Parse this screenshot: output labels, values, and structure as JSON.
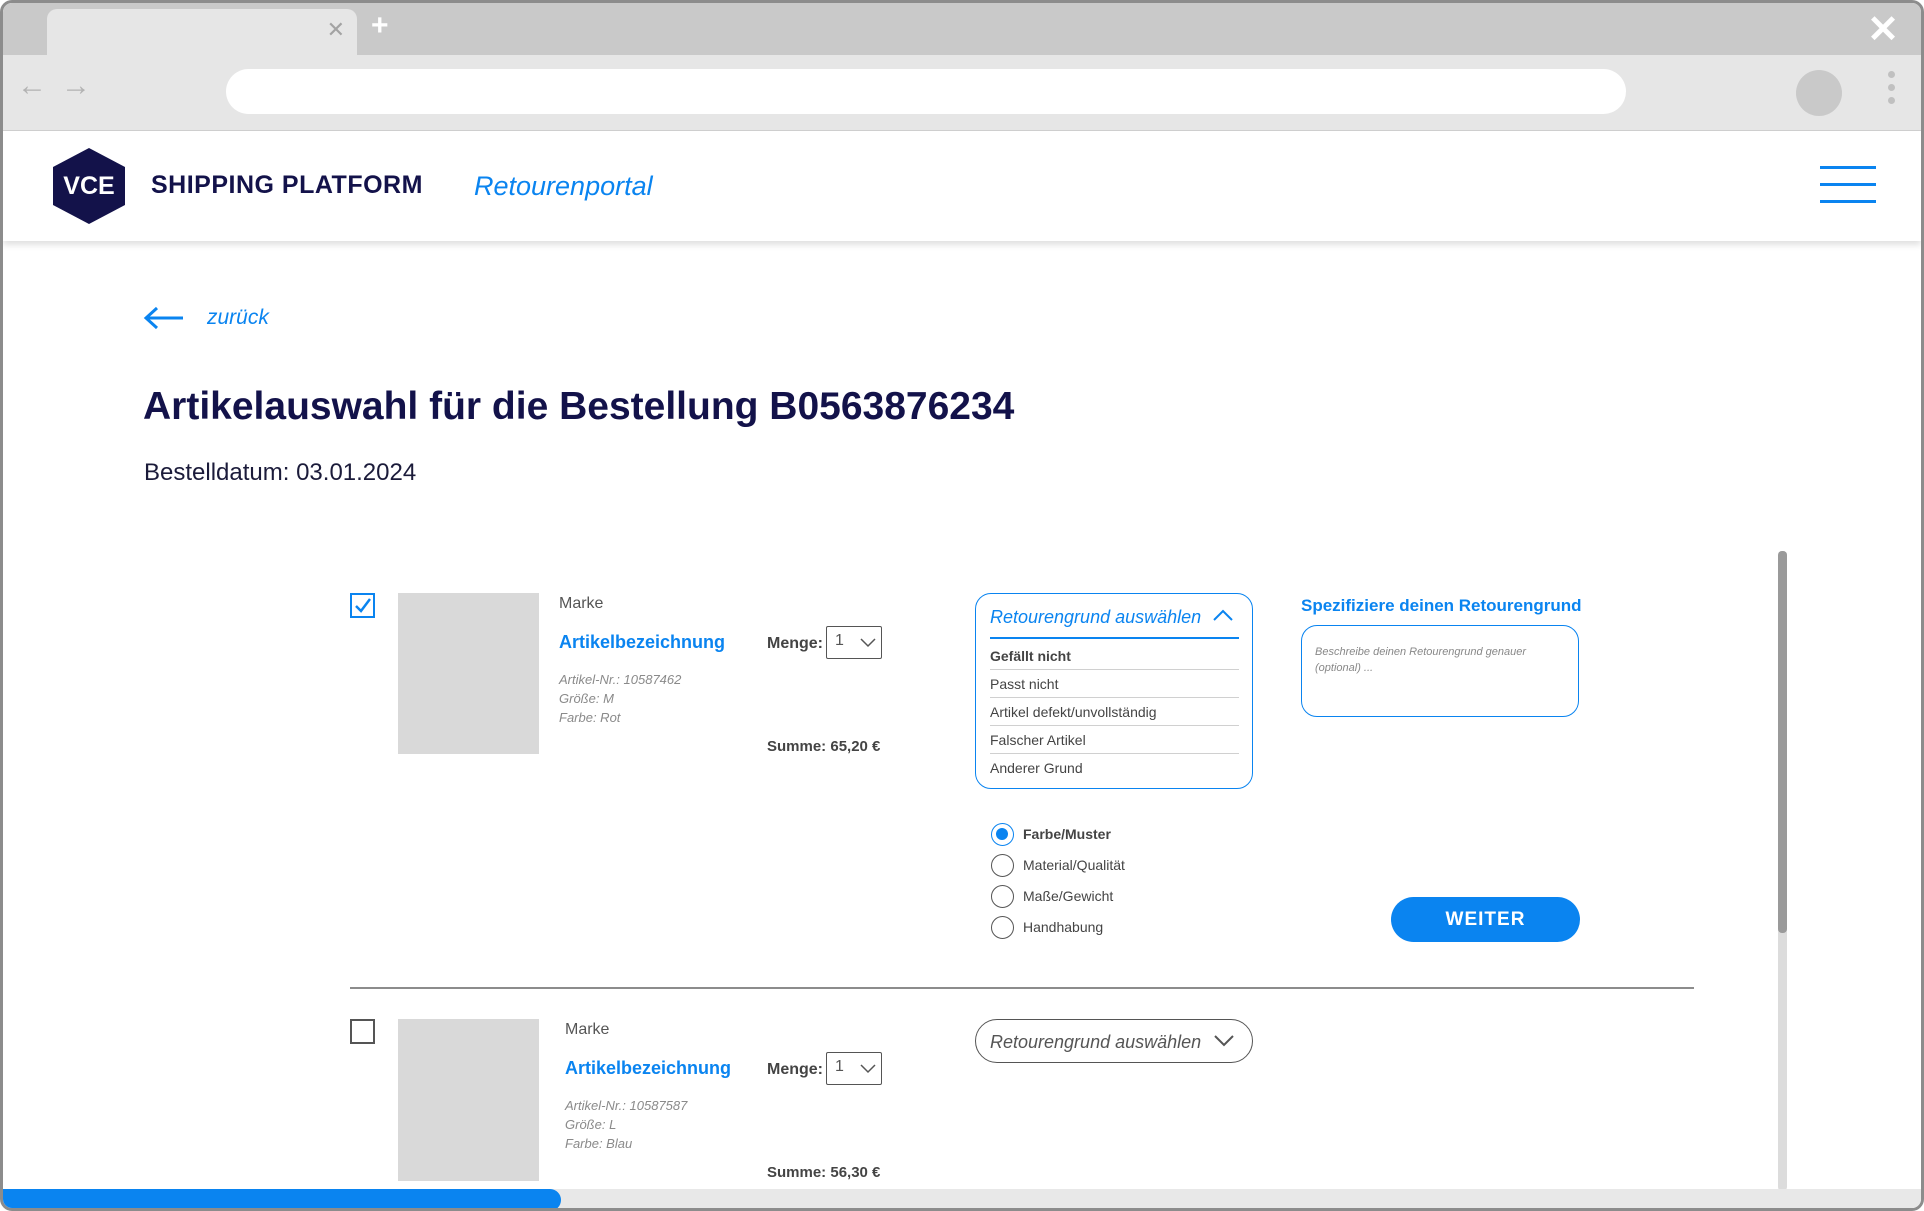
{
  "browser": {
    "tab_close_glyph": "✕",
    "new_tab_glyph": "+",
    "window_close_glyph": "✕",
    "back_glyph": "←",
    "forward_glyph": "→"
  },
  "header": {
    "logo_text": "VCE",
    "brand": "SHIPPING PLATFORM",
    "portal": "Retourenportal"
  },
  "page": {
    "back_label": "zurück",
    "title": "Artikelauswahl für die Bestellung B0563876234",
    "order_date": "Bestelldatum: 03.01.2024"
  },
  "items": [
    {
      "checked": true,
      "brand": "Marke",
      "name": "Artikelbezeichnung",
      "article_no": "Artikel-Nr.: 10587462",
      "size": "Größe: M",
      "color": "Farbe: Rot",
      "qty_label": "Menge:",
      "qty_value": "1",
      "sum": "Summe: 65,20 €",
      "reason_placeholder": "Retourengrund auswählen",
      "reason_options": [
        "Gefällt nicht",
        "Passt nicht",
        "Artikel defekt/unvollständig",
        "Falscher Artikel",
        "Anderer Grund"
      ],
      "spec_title": "Spezifiziere deinen Retourengrund",
      "spec_placeholder": "Beschreibe deinen Retourengrund genauer (optional) ...",
      "sub_reasons": [
        "Farbe/Muster",
        "Material/Qualität",
        "Maße/Gewicht",
        "Handhabung"
      ],
      "sub_reason_selected": "Farbe/Muster",
      "continue_label": "WEITER"
    },
    {
      "checked": false,
      "brand": "Marke",
      "name": "Artikelbezeichnung",
      "article_no": "Artikel-Nr.: 10587587",
      "size": "Größe: L",
      "color": "Farbe: Blau",
      "qty_label": "Menge:",
      "qty_value": "1",
      "sum": "Summe: 56,30 €",
      "reason_placeholder": "Retourengrund auswählen"
    }
  ],
  "progress": {
    "fraction": 0.29
  },
  "colors": {
    "accent": "#0a84f0",
    "navy": "#13124a",
    "placeholder_grey": "#d9d9d9"
  }
}
